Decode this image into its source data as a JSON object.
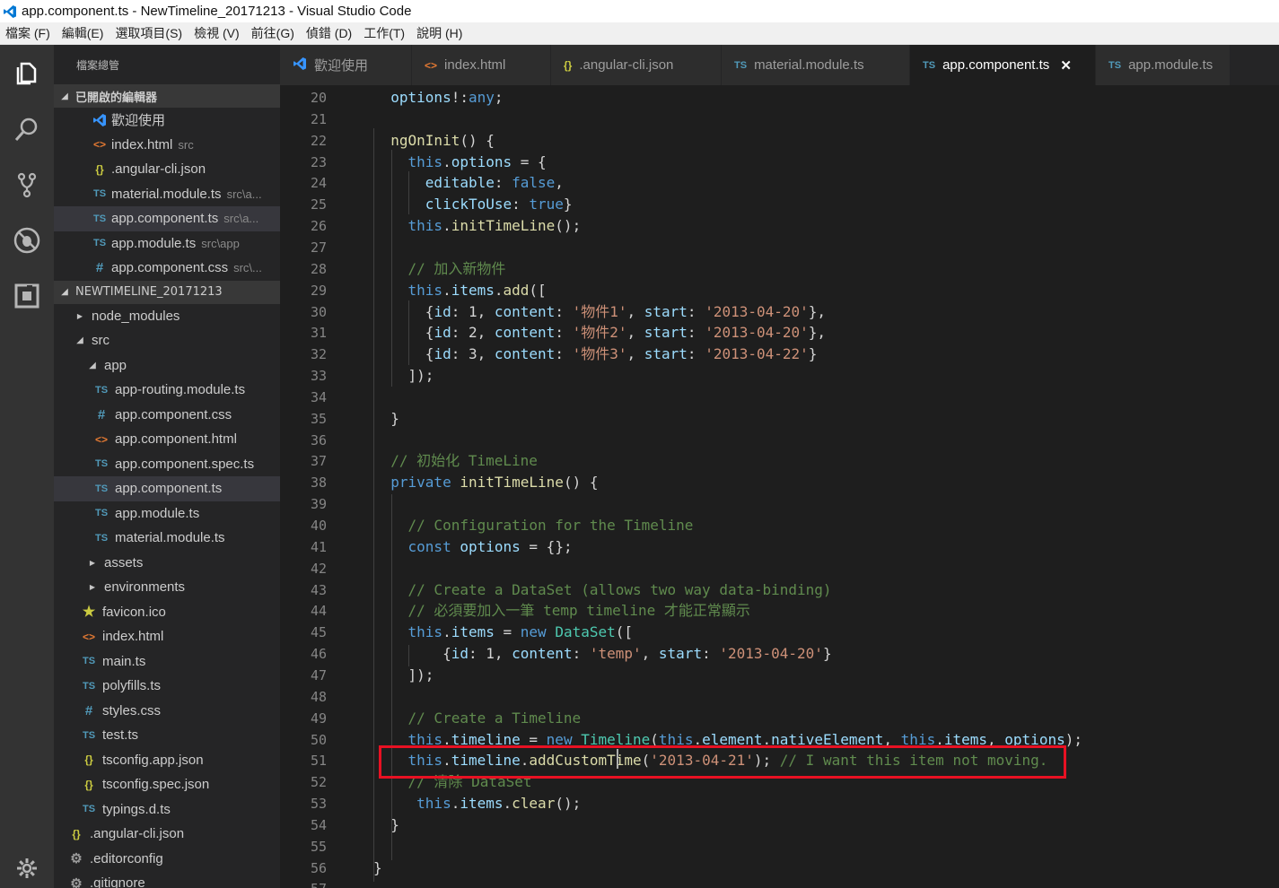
{
  "window": {
    "title": "app.component.ts - NewTimeline_20171213 - Visual Studio Code"
  },
  "menu": [
    "檔案 (F)",
    "編輯(E)",
    "選取項目(S)",
    "檢視 (V)",
    "前往(G)",
    "偵錯 (D)",
    "工作(T)",
    "說明 (H)"
  ],
  "activity_bar": {
    "items": [
      "explorer-icon",
      "search-icon",
      "source-control-icon",
      "debug-icon",
      "extensions-icon"
    ],
    "bottom": "settings-gear-icon"
  },
  "sidebar": {
    "title": "檔案總管",
    "open_editors": {
      "header": "已開啟的編輯器",
      "items": [
        {
          "icon": "vscode",
          "name": "歡迎使用",
          "desc": ""
        },
        {
          "icon": "html",
          "name": "index.html",
          "desc": "src"
        },
        {
          "icon": "json",
          "name": ".angular-cli.json",
          "desc": ""
        },
        {
          "icon": "ts",
          "name": "material.module.ts",
          "desc": "src\\a..."
        },
        {
          "icon": "ts",
          "name": "app.component.ts",
          "desc": "src\\a..."
        },
        {
          "icon": "ts",
          "name": "app.module.ts",
          "desc": "src\\app"
        },
        {
          "icon": "css",
          "name": "app.component.css",
          "desc": "src\\..."
        }
      ]
    },
    "project": {
      "header": "NEWTIMELINE_20171213",
      "items": [
        {
          "icon": "folder",
          "name": "node_modules",
          "expanded": false
        },
        {
          "icon": "folder",
          "name": "src",
          "expanded": true
        },
        {
          "icon": "folder",
          "name": "app",
          "expanded": true
        },
        {
          "icon": "ts",
          "name": "app-routing.module.ts"
        },
        {
          "icon": "css",
          "name": "app.component.css"
        },
        {
          "icon": "html",
          "name": "app.component.html"
        },
        {
          "icon": "ts",
          "name": "app.component.spec.ts"
        },
        {
          "icon": "ts",
          "name": "app.component.ts"
        },
        {
          "icon": "ts",
          "name": "app.module.ts"
        },
        {
          "icon": "ts",
          "name": "material.module.ts"
        },
        {
          "icon": "folder",
          "name": "assets",
          "expanded": false
        },
        {
          "icon": "folder",
          "name": "environments",
          "expanded": false
        },
        {
          "icon": "star",
          "name": "favicon.ico"
        },
        {
          "icon": "html",
          "name": "index.html"
        },
        {
          "icon": "ts",
          "name": "main.ts"
        },
        {
          "icon": "ts",
          "name": "polyfills.ts"
        },
        {
          "icon": "css",
          "name": "styles.css"
        },
        {
          "icon": "ts",
          "name": "test.ts"
        },
        {
          "icon": "json",
          "name": "tsconfig.app.json"
        },
        {
          "icon": "json",
          "name": "tsconfig.spec.json"
        },
        {
          "icon": "ts",
          "name": "typings.d.ts"
        },
        {
          "icon": "json",
          "name": ".angular-cli.json"
        },
        {
          "icon": "gear",
          "name": ".editorconfig"
        },
        {
          "icon": "gear",
          "name": ".gitignore"
        }
      ]
    }
  },
  "tabs": [
    {
      "icon": "vscode",
      "label": "歡迎使用",
      "active": false
    },
    {
      "icon": "html",
      "label": "index.html",
      "active": false
    },
    {
      "icon": "json",
      "label": ".angular-cli.json",
      "active": false
    },
    {
      "icon": "ts",
      "label": "material.module.ts",
      "active": false
    },
    {
      "icon": "ts",
      "label": "app.component.ts",
      "active": true
    },
    {
      "icon": "ts",
      "label": "app.module.ts",
      "active": false
    }
  ],
  "icon_glyphs": {
    "ts": "TS",
    "html": "<>",
    "json": "{}",
    "css": "#",
    "star": "★",
    "gear": "⚙",
    "close": "✕"
  },
  "editor": {
    "lines": [
      {
        "n": "20",
        "tokens": [
          [
            "prop",
            "  options"
          ],
          [
            "",
            "!:"
          ],
          [
            "kw",
            "any"
          ],
          [
            "",
            ";"
          ]
        ]
      },
      {
        "n": "21",
        "tokens": []
      },
      {
        "n": "22",
        "tokens": [
          [
            "fn",
            "  ngOnInit"
          ],
          [
            "",
            "() {"
          ]
        ]
      },
      {
        "n": "23",
        "tokens": [
          [
            "kw",
            "    this"
          ],
          [
            "",
            "."
          ],
          [
            "prop",
            "options"
          ],
          [
            "",
            " = {"
          ]
        ]
      },
      {
        "n": "24",
        "tokens": [
          [
            "prop",
            "      editable"
          ],
          [
            "",
            ": "
          ],
          [
            "kw",
            "false"
          ],
          [
            "",
            ","
          ]
        ]
      },
      {
        "n": "25",
        "tokens": [
          [
            "prop",
            "      clickToUse"
          ],
          [
            "",
            ": "
          ],
          [
            "kw",
            "true"
          ],
          [
            "",
            "}"
          ]
        ]
      },
      {
        "n": "26",
        "tokens": [
          [
            "kw",
            "    this"
          ],
          [
            "",
            "."
          ],
          [
            "fn",
            "initTimeLine"
          ],
          [
            "",
            "();"
          ]
        ]
      },
      {
        "n": "27",
        "tokens": []
      },
      {
        "n": "28",
        "tokens": [
          [
            "cmt",
            "    // 加入新物件"
          ]
        ]
      },
      {
        "n": "29",
        "tokens": [
          [
            "kw",
            "    this"
          ],
          [
            "",
            "."
          ],
          [
            "prop",
            "items"
          ],
          [
            "",
            "."
          ],
          [
            "fn",
            "add"
          ],
          [
            "",
            "(["
          ]
        ]
      },
      {
        "n": "30",
        "tokens": [
          [
            "",
            "      {"
          ],
          [
            "prop",
            "id"
          ],
          [
            "",
            ": "
          ],
          [
            "",
            "1"
          ],
          [
            "",
            ", "
          ],
          [
            "prop",
            "content"
          ],
          [
            "",
            ": "
          ],
          [
            "str",
            "'物件1'"
          ],
          [
            "",
            ", "
          ],
          [
            "prop",
            "start"
          ],
          [
            "",
            ": "
          ],
          [
            "str",
            "'2013-04-20'"
          ],
          [
            "",
            "},"
          ]
        ]
      },
      {
        "n": "31",
        "tokens": [
          [
            "",
            "      {"
          ],
          [
            "prop",
            "id"
          ],
          [
            "",
            ": "
          ],
          [
            "",
            "2"
          ],
          [
            "",
            ", "
          ],
          [
            "prop",
            "content"
          ],
          [
            "",
            ": "
          ],
          [
            "str",
            "'物件2'"
          ],
          [
            "",
            ", "
          ],
          [
            "prop",
            "start"
          ],
          [
            "",
            ": "
          ],
          [
            "str",
            "'2013-04-20'"
          ],
          [
            "",
            "},"
          ]
        ]
      },
      {
        "n": "32",
        "tokens": [
          [
            "",
            "      {"
          ],
          [
            "prop",
            "id"
          ],
          [
            "",
            ": "
          ],
          [
            "",
            "3"
          ],
          [
            "",
            ", "
          ],
          [
            "prop",
            "content"
          ],
          [
            "",
            ": "
          ],
          [
            "str",
            "'物件3'"
          ],
          [
            "",
            ", "
          ],
          [
            "prop",
            "start"
          ],
          [
            "",
            ": "
          ],
          [
            "str",
            "'2013-04-22'"
          ],
          [
            "",
            "}"
          ]
        ]
      },
      {
        "n": "33",
        "tokens": [
          [
            "",
            "    ]);"
          ]
        ]
      },
      {
        "n": "34",
        "tokens": []
      },
      {
        "n": "35",
        "tokens": [
          [
            "",
            "  }"
          ]
        ]
      },
      {
        "n": "36",
        "tokens": []
      },
      {
        "n": "37",
        "tokens": [
          [
            "cmt",
            "  // 初始化 TimeLine"
          ]
        ]
      },
      {
        "n": "38",
        "tokens": [
          [
            "kw",
            "  private"
          ],
          [
            "",
            " "
          ],
          [
            "fn",
            "initTimeLine"
          ],
          [
            "",
            "() {"
          ]
        ]
      },
      {
        "n": "39",
        "tokens": []
      },
      {
        "n": "40",
        "tokens": [
          [
            "cmt",
            "    // Configuration for the Timeline"
          ]
        ]
      },
      {
        "n": "41",
        "tokens": [
          [
            "kw",
            "    const"
          ],
          [
            "",
            " "
          ],
          [
            "prop",
            "options"
          ],
          [
            "",
            " = {};"
          ]
        ]
      },
      {
        "n": "42",
        "tokens": []
      },
      {
        "n": "43",
        "tokens": [
          [
            "cmt",
            "    // Create a DataSet (allows two way data-binding)"
          ]
        ]
      },
      {
        "n": "44",
        "tokens": [
          [
            "cmt",
            "    // 必須要加入一筆 temp timeline 才能正常顯示"
          ]
        ]
      },
      {
        "n": "45",
        "tokens": [
          [
            "kw",
            "    this"
          ],
          [
            "",
            "."
          ],
          [
            "prop",
            "items"
          ],
          [
            "",
            " = "
          ],
          [
            "kw",
            "new"
          ],
          [
            "",
            " "
          ],
          [
            "typ",
            "DataSet"
          ],
          [
            "",
            "(["
          ]
        ]
      },
      {
        "n": "46",
        "tokens": [
          [
            "",
            "        {"
          ],
          [
            "prop",
            "id"
          ],
          [
            "",
            ": "
          ],
          [
            "",
            "1"
          ],
          [
            "",
            ", "
          ],
          [
            "prop",
            "content"
          ],
          [
            "",
            ": "
          ],
          [
            "str",
            "'temp'"
          ],
          [
            "",
            ", "
          ],
          [
            "prop",
            "start"
          ],
          [
            "",
            ": "
          ],
          [
            "str",
            "'2013-04-20'"
          ],
          [
            "",
            "}"
          ]
        ]
      },
      {
        "n": "47",
        "tokens": [
          [
            "",
            "    ]);"
          ]
        ]
      },
      {
        "n": "48",
        "tokens": []
      },
      {
        "n": "49",
        "tokens": [
          [
            "cmt",
            "    // Create a Timeline"
          ]
        ]
      },
      {
        "n": "50",
        "tokens": [
          [
            "kw",
            "    this"
          ],
          [
            "",
            "."
          ],
          [
            "prop",
            "timeline"
          ],
          [
            "",
            " = "
          ],
          [
            "kw",
            "new"
          ],
          [
            "",
            " "
          ],
          [
            "typ",
            "Timeline"
          ],
          [
            "",
            "("
          ],
          [
            "kw",
            "this"
          ],
          [
            "",
            "."
          ],
          [
            "prop",
            "element"
          ],
          [
            "",
            "."
          ],
          [
            "prop",
            "nativeElement"
          ],
          [
            "",
            ", "
          ],
          [
            "kw",
            "this"
          ],
          [
            "",
            "."
          ],
          [
            "prop",
            "items"
          ],
          [
            "",
            ", "
          ],
          [
            "prop",
            "options"
          ],
          [
            "",
            ");"
          ]
        ]
      },
      {
        "n": "51",
        "tokens": [
          [
            "kw",
            "    this"
          ],
          [
            "",
            "."
          ],
          [
            "prop",
            "timeline"
          ],
          [
            "",
            "."
          ],
          [
            "fn",
            "addCustomTime"
          ],
          [
            "",
            "("
          ],
          [
            "str",
            "'2013-04-21'"
          ],
          [
            "",
            "); "
          ],
          [
            "cmt",
            "// I want this item not moving."
          ]
        ]
      },
      {
        "n": "52",
        "tokens": [
          [
            "cmt",
            "    // 清除 DataSet"
          ]
        ]
      },
      {
        "n": "53",
        "tokens": [
          [
            "kw",
            "     this"
          ],
          [
            "",
            "."
          ],
          [
            "prop",
            "items"
          ],
          [
            "",
            "."
          ],
          [
            "fn",
            "clear"
          ],
          [
            "",
            "();"
          ]
        ]
      },
      {
        "n": "54",
        "tokens": [
          [
            "",
            "  }"
          ]
        ]
      },
      {
        "n": "55",
        "tokens": []
      },
      {
        "n": "56",
        "tokens": [
          [
            "",
            "}"
          ]
        ]
      },
      {
        "n": "57",
        "tokens": []
      }
    ]
  }
}
